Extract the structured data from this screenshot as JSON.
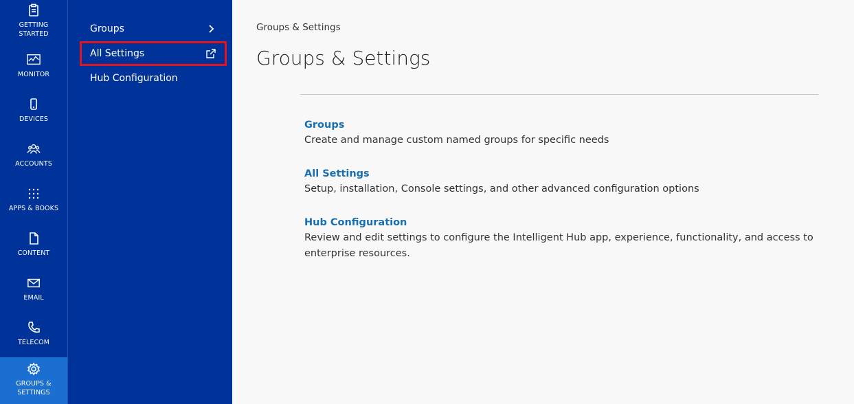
{
  "rail": {
    "items": [
      {
        "label": "GETTING\nSTARTED",
        "icon": "clipboard-icon"
      },
      {
        "label": "MONITOR",
        "icon": "monitor-chart-icon"
      },
      {
        "label": "DEVICES",
        "icon": "phone-icon"
      },
      {
        "label": "ACCOUNTS",
        "icon": "users-icon"
      },
      {
        "label": "APPS & BOOKS",
        "icon": "grid-icon"
      },
      {
        "label": "CONTENT",
        "icon": "document-icon"
      },
      {
        "label": "EMAIL",
        "icon": "envelope-icon"
      },
      {
        "label": "TELECOM",
        "icon": "telephone-icon"
      },
      {
        "label": "GROUPS &\nSETTINGS",
        "icon": "gear-icon",
        "active": true
      }
    ]
  },
  "subnav": {
    "items": [
      {
        "label": "Groups",
        "trailing_icon": "chevron-right-icon"
      },
      {
        "label": "All Settings",
        "trailing_icon": "external-link-icon",
        "highlighted": true
      },
      {
        "label": "Hub Configuration"
      }
    ]
  },
  "main": {
    "breadcrumb": "Groups & Settings",
    "title": "Groups & Settings",
    "entries": [
      {
        "heading": "Groups",
        "description": "Create and manage custom named groups for specific needs"
      },
      {
        "heading": "All Settings",
        "description": "Setup, installation, Console settings, and other advanced configuration options"
      },
      {
        "heading": "Hub Configuration",
        "description": "Review and edit settings to configure the Intelligent Hub app, experience, functionality, and access to enterprise resources."
      }
    ]
  },
  "colors": {
    "rail_bg": "#003399",
    "active_bg": "#1a6fd1",
    "highlight_border": "#e0151f",
    "link": "#1a6faf"
  }
}
